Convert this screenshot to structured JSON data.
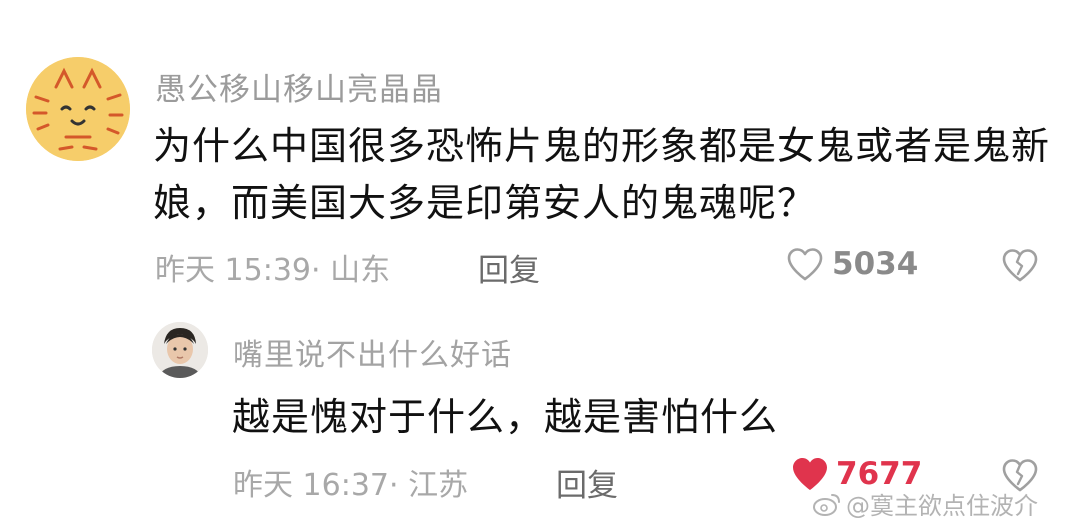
{
  "main_comment": {
    "username": "愚公移山移山亮晶晶",
    "content": "为什么中国很多恐怖片鬼的形象都是女鬼或者是鬼新娘，而美国大多是印第安人的鬼魂呢？",
    "meta": "昨天 15:39· 山东",
    "reply_label": "回复",
    "like_count": "5034",
    "liked": false
  },
  "reply_comment": {
    "username": "嘴里说不出什么好话",
    "content": "越是愧对于什么，越是害怕什么",
    "meta": "昨天 16:37· 江苏",
    "reply_label": "回复",
    "like_count": "7677",
    "liked": true
  },
  "watermark": {
    "text": "@寞主欲点住波介"
  },
  "colors": {
    "like_active": "#e0344d",
    "avatar_main_bg": "#f6cd6a",
    "username": "#9b9b9b",
    "content": "#111111"
  },
  "icons": {
    "like": "heart-icon",
    "dislike": "broken-heart-icon",
    "watermark": "weibo-logo-icon"
  }
}
